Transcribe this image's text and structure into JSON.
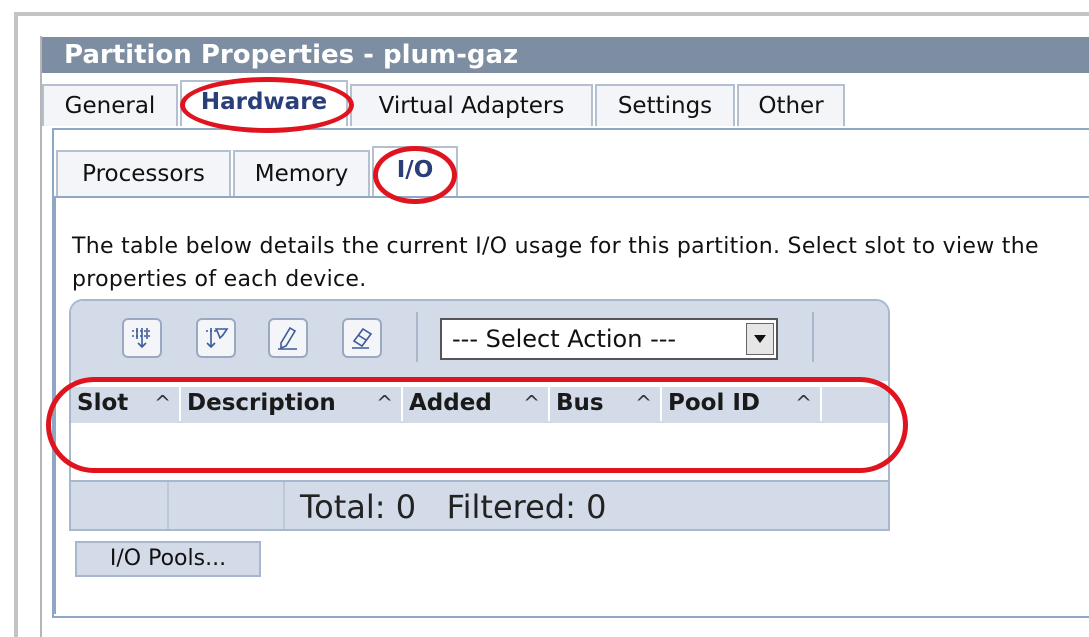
{
  "window": {
    "title": "Partition Properties - plum-gaz"
  },
  "tabs": [
    {
      "label": "General"
    },
    {
      "label": "Hardware"
    },
    {
      "label": "Virtual Adapters"
    },
    {
      "label": "Settings"
    },
    {
      "label": "Other"
    }
  ],
  "subtabs": [
    {
      "label": "Processors"
    },
    {
      "label": "Memory"
    },
    {
      "label": "I/O"
    }
  ],
  "description": "The table below details the current I/O usage for this partition. Select slot to view the properties of each device.",
  "toolbar": {
    "select_action": "--- Select Action ---"
  },
  "table": {
    "columns": [
      {
        "label": "Slot",
        "sort": "^"
      },
      {
        "label": "Description",
        "sort": "^"
      },
      {
        "label": "Added",
        "sort": "^"
      },
      {
        "label": "Bus",
        "sort": "^"
      },
      {
        "label": "Pool ID",
        "sort": "^"
      }
    ],
    "footer": "Total: 0   Filtered: 0"
  },
  "buttons": {
    "io_pools": "I/O Pools..."
  },
  "colors": {
    "title_bar": "#7e8ea2",
    "toolbar": "#d3dbe8",
    "highlight": "#e0141e",
    "active_tab_text": "#2a3e7a"
  }
}
